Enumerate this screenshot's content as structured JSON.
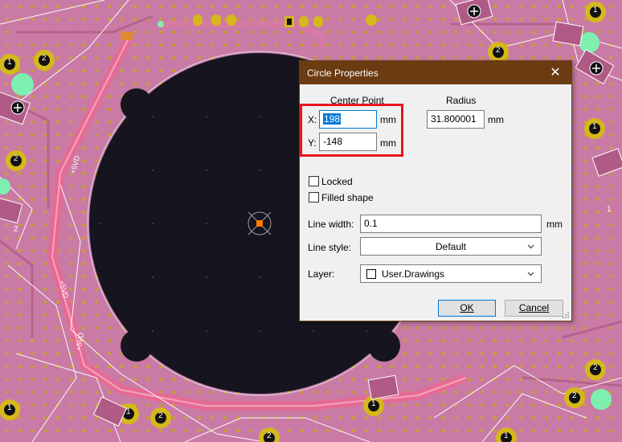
{
  "pcb": {
    "net_labels": [
      "+5VD",
      "+5VD",
      "+5VD"
    ],
    "pad_numbers": [
      "1",
      "2",
      "2",
      "1",
      "2",
      "1",
      "2",
      "1",
      "2",
      "1",
      "2",
      "1",
      "2",
      "1",
      "2",
      "1"
    ],
    "colors": {
      "board": "#c97ba6",
      "canvas": "#16151f",
      "trace": "#e76a93",
      "via": "#d5b81a",
      "pad_green": "#7df0b0",
      "outline": "#ffffff"
    }
  },
  "dialog": {
    "title": "Circle Properties",
    "close_glyph": "✕",
    "center_point_label": "Center Point",
    "radius_label": "Radius",
    "x_label": "X:",
    "x_value": "198",
    "x_unit": "mm",
    "y_label": "Y:",
    "y_value": "-148",
    "y_unit": "mm",
    "radius_value": "31.800001",
    "radius_unit": "mm",
    "locked_label": "Locked",
    "filled_label": "Filled shape",
    "line_width_label": "Line width:",
    "line_width_value": "0.1",
    "line_width_unit": "mm",
    "line_style_label": "Line style:",
    "line_style_value": "Default",
    "layer_label": "Layer:",
    "layer_value": "User.Drawings",
    "ok_label": "OK",
    "cancel_label": "Cancel"
  }
}
